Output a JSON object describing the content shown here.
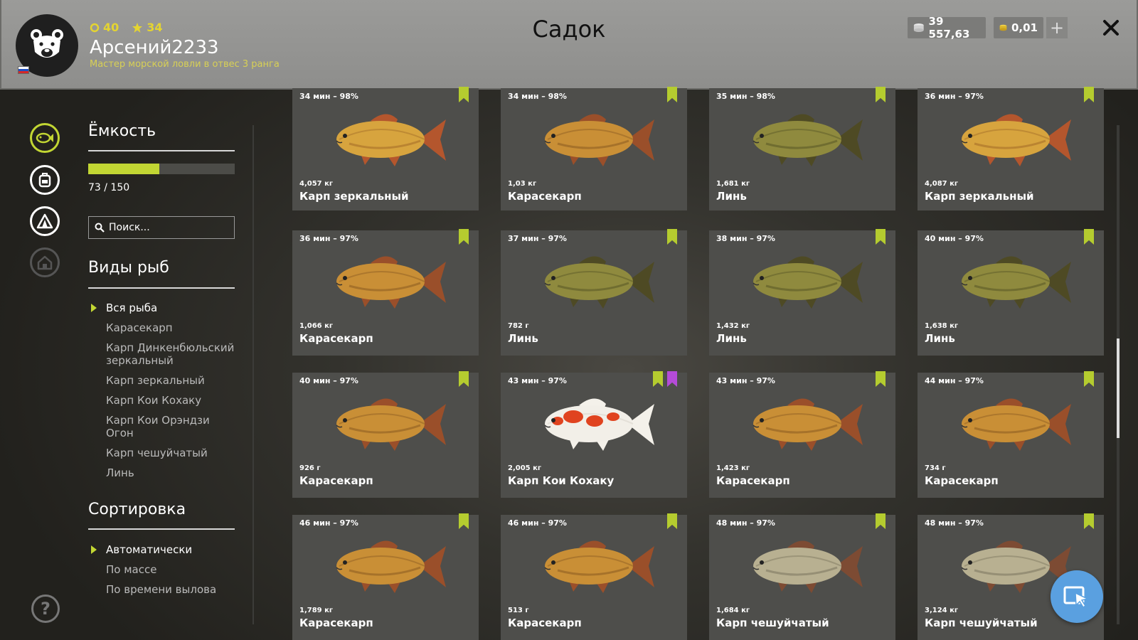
{
  "header": {
    "level": "40",
    "stars": "34",
    "username": "Арсений2233",
    "rank_title": "Мастер морской ловли в отвес 3 ранга",
    "page_title": "Садок",
    "silver": "39 557,63",
    "gold": "0,01",
    "accent_color": "#c2d633"
  },
  "sidebar": {
    "capacity_title": "Ёмкость",
    "capacity_used": 73,
    "capacity_max": 150,
    "capacity_text": "73 / 150",
    "search_placeholder": "Поиск...",
    "species_title": "Виды рыб",
    "species": [
      {
        "label": "Вся рыба",
        "selected": true
      },
      {
        "label": "Карасекарп",
        "selected": false
      },
      {
        "label": "Карп Динкенбюльский зеркальный",
        "selected": false
      },
      {
        "label": "Карп зеркальный",
        "selected": false
      },
      {
        "label": "Карп Кои Кохаку",
        "selected": false
      },
      {
        "label": "Карп Кои Орэндзи Огон",
        "selected": false
      },
      {
        "label": "Карп чешуйчатый",
        "selected": false
      },
      {
        "label": "Линь",
        "selected": false
      }
    ],
    "sort_title": "Сортировка",
    "sort_options": [
      {
        "label": "Автоматически",
        "selected": true
      },
      {
        "label": "По массе",
        "selected": false
      },
      {
        "label": "По времени вылова",
        "selected": false
      }
    ]
  },
  "fish": [
    {
      "time": "34 мин – 98%",
      "weight": "4,057 кг",
      "name": "Карп зеркальный",
      "kind": "mirror",
      "extra_mark": false
    },
    {
      "time": "34 мин – 98%",
      "weight": "1,03 кг",
      "name": "Карасекарп",
      "kind": "crucian",
      "extra_mark": false
    },
    {
      "time": "35 мин – 98%",
      "weight": "1,681 кг",
      "name": "Линь",
      "kind": "tench",
      "extra_mark": false
    },
    {
      "time": "36 мин – 97%",
      "weight": "4,087 кг",
      "name": "Карп зеркальный",
      "kind": "mirror",
      "extra_mark": false
    },
    {
      "time": "36 мин – 97%",
      "weight": "1,066 кг",
      "name": "Карасекарп",
      "kind": "crucian",
      "extra_mark": false
    },
    {
      "time": "37 мин – 97%",
      "weight": "782 г",
      "name": "Линь",
      "kind": "tench",
      "extra_mark": false
    },
    {
      "time": "38 мин – 97%",
      "weight": "1,432 кг",
      "name": "Линь",
      "kind": "tench",
      "extra_mark": false
    },
    {
      "time": "40 мин – 97%",
      "weight": "1,638 кг",
      "name": "Линь",
      "kind": "tench",
      "extra_mark": false
    },
    {
      "time": "40 мин – 97%",
      "weight": "926 г",
      "name": "Карасекарп",
      "kind": "crucian",
      "extra_mark": false
    },
    {
      "time": "43 мин – 97%",
      "weight": "2,005 кг",
      "name": "Карп Кои Кохаку",
      "kind": "koi",
      "extra_mark": true
    },
    {
      "time": "43 мин – 97%",
      "weight": "1,423 кг",
      "name": "Карасекарп",
      "kind": "crucian",
      "extra_mark": false
    },
    {
      "time": "44 мин – 97%",
      "weight": "734 г",
      "name": "Карасекарп",
      "kind": "crucian",
      "extra_mark": false
    },
    {
      "time": "46 мин – 97%",
      "weight": "1,789 кг",
      "name": "Карасекарп",
      "kind": "crucian",
      "extra_mark": false
    },
    {
      "time": "46 мин – 97%",
      "weight": "513 г",
      "name": "Карасекарп",
      "kind": "crucian",
      "extra_mark": false
    },
    {
      "time": "48 мин – 97%",
      "weight": "1,684 кг",
      "name": "Карп чешуйчатый",
      "kind": "scaled",
      "extra_mark": false
    },
    {
      "time": "48 мин – 97%",
      "weight": "3,124 кг",
      "name": "Карп чешуйчатый",
      "kind": "scaled",
      "extra_mark": false
    }
  ]
}
